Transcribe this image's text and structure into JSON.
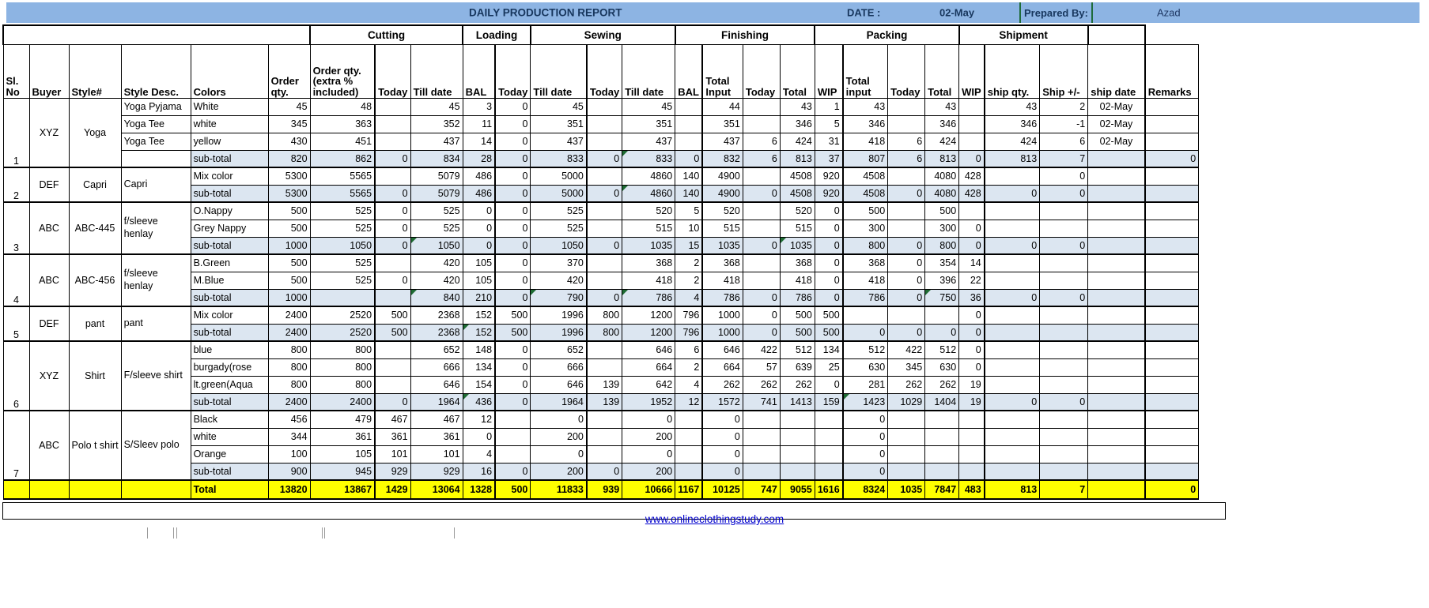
{
  "title": {
    "report": "DAILY PRODUCTION REPORT",
    "date_label": "DATE :",
    "date_value": "02-May",
    "prepared_label": "Prepared By:",
    "prepared_value": "Azad"
  },
  "groups": [
    {
      "label": "",
      "span": 6,
      "style": "beige"
    },
    {
      "label": "Cutting",
      "span": 3,
      "style": "white"
    },
    {
      "label": "Loading",
      "span": 2,
      "style": "green"
    },
    {
      "label": "Sewing",
      "span": 3,
      "style": "white"
    },
    {
      "label": "Finishing",
      "span": 4,
      "style": "green"
    },
    {
      "label": "Packing",
      "span": 4,
      "style": "white"
    },
    {
      "label": "Shipment",
      "span": 3,
      "style": "green"
    },
    {
      "label": "",
      "span": 1,
      "style": "blank"
    }
  ],
  "columns": [
    "Sl. No",
    "Buyer",
    "Style#",
    "Style Desc.",
    "Colors",
    "Order qty.",
    "Order qty. (extra % included)",
    "Today",
    "Till date",
    "BAL",
    "Today",
    "Till date",
    "Today",
    "Till date",
    "BAL",
    "Total Input",
    "Today",
    "Total",
    "WIP",
    "Total input",
    "Today",
    "Total",
    "WIP",
    "ship qty.",
    "Ship +/-",
    "ship date",
    "Remarks"
  ],
  "blocks": [
    {
      "sl": "1",
      "buyer": "XYZ",
      "style": "Yoga",
      "rows": [
        {
          "desc": "Yoga Pyjama",
          "color": "White",
          "v": [
            "45",
            "48",
            "",
            "45",
            "3",
            "0",
            "45",
            "",
            "45",
            "",
            "44",
            "",
            "43",
            "1",
            "43",
            "",
            "43",
            "",
            "43",
            "2",
            "02-May",
            ""
          ]
        },
        {
          "desc": "Yoga Tee",
          "color": "white",
          "v": [
            "345",
            "363",
            "",
            "352",
            "11",
            "0",
            "351",
            "",
            "351",
            "",
            "351",
            "",
            "346",
            "5",
            "346",
            "",
            "346",
            "",
            "346",
            "-1",
            "02-May",
            ""
          ]
        },
        {
          "desc": "Yoga Tee",
          "color": "yellow",
          "v": [
            "430",
            "451",
            "",
            "437",
            "14",
            "0",
            "437",
            "",
            "437",
            "",
            "437",
            "6",
            "424",
            "31",
            "418",
            "6",
            "424",
            "",
            "424",
            "6",
            "02-May",
            ""
          ]
        }
      ],
      "subtotal": {
        "desc": "",
        "color": "sub-total",
        "v": [
          "820",
          "862",
          "0",
          "834",
          "28",
          "0",
          "833",
          "0",
          "833",
          "0",
          "832",
          "6",
          "813",
          "37",
          "807",
          "6",
          "813",
          "0",
          "813",
          "7",
          "",
          "0"
        ]
      }
    },
    {
      "sl": "2",
      "buyer": "DEF",
      "style": "Capri",
      "desc_merged": "Capri",
      "rows": [
        {
          "desc": "Capri",
          "color": "Mix color",
          "v": [
            "5300",
            "5565",
            "",
            "5079",
            "486",
            "0",
            "5000",
            "",
            "4860",
            "140",
            "4900",
            "",
            "4508",
            "920",
            "4508",
            "",
            "4080",
            "428",
            "",
            "0",
            "",
            ""
          ]
        }
      ],
      "subtotal": {
        "desc": "",
        "color": "sub-total",
        "v": [
          "5300",
          "5565",
          "0",
          "5079",
          "486",
          "0",
          "5000",
          "0",
          "4860",
          "140",
          "4900",
          "0",
          "4508",
          "920",
          "4508",
          "0",
          "4080",
          "428",
          "0",
          "0",
          "",
          ""
        ]
      }
    },
    {
      "sl": "3",
      "buyer": "ABC",
      "style": "ABC-445",
      "desc_merged": "f/sleeve henlay",
      "rows": [
        {
          "desc": "",
          "color": "O.Nappy",
          "v": [
            "500",
            "525",
            "0",
            "525",
            "0",
            "0",
            "525",
            "",
            "520",
            "5",
            "520",
            "",
            "520",
            "0",
            "500",
            "",
            "500",
            "",
            "",
            "",
            "",
            ""
          ]
        },
        {
          "desc": "",
          "color": "Grey Nappy",
          "v": [
            "500",
            "525",
            "0",
            "525",
            "0",
            "0",
            "525",
            "",
            "515",
            "10",
            "515",
            "",
            "515",
            "0",
            "300",
            "",
            "300",
            "0",
            "",
            "",
            "",
            ""
          ]
        }
      ],
      "subtotal": {
        "desc": "",
        "color": "sub-total",
        "v": [
          "1000",
          "1050",
          "0",
          "1050",
          "0",
          "0",
          "1050",
          "0",
          "1035",
          "15",
          "1035",
          "0",
          "1035",
          "0",
          "800",
          "0",
          "800",
          "0",
          "0",
          "0",
          "",
          ""
        ]
      }
    },
    {
      "sl": "4",
      "buyer": "ABC",
      "style": "ABC-456",
      "desc_merged": "f/sleeve henlay",
      "rows": [
        {
          "desc": "",
          "color": "B.Green",
          "v": [
            "500",
            "525",
            "",
            "420",
            "105",
            "0",
            "370",
            "",
            "368",
            "2",
            "368",
            "",
            "368",
            "0",
            "368",
            "0",
            "354",
            "14",
            "",
            "",
            "",
            ""
          ]
        },
        {
          "desc": "",
          "color": "M.Blue",
          "v": [
            "500",
            "525",
            "0",
            "420",
            "105",
            "0",
            "420",
            "",
            "418",
            "2",
            "418",
            "",
            "418",
            "0",
            "418",
            "0",
            "396",
            "22",
            "",
            "",
            "",
            ""
          ]
        }
      ],
      "subtotal": {
        "desc": "",
        "color": "sub-total",
        "v": [
          "1000",
          "",
          "",
          "840",
          "210",
          "0",
          "790",
          "0",
          "786",
          "4",
          "786",
          "0",
          "786",
          "0",
          "786",
          "0",
          "750",
          "36",
          "0",
          "0",
          "",
          ""
        ]
      }
    },
    {
      "sl": "5",
      "buyer": "DEF",
      "style": "pant",
      "desc_merged": "pant",
      "rows": [
        {
          "desc": "",
          "color": "Mix color",
          "v": [
            "2400",
            "2520",
            "500",
            "2368",
            "152",
            "500",
            "1996",
            "800",
            "1200",
            "796",
            "1000",
            "0",
            "500",
            "500",
            "",
            "",
            "",
            "0",
            "",
            "",
            "",
            ""
          ]
        }
      ],
      "subtotal": {
        "desc": "",
        "color": "sub-total",
        "v": [
          "2400",
          "2520",
          "500",
          "2368",
          "152",
          "500",
          "1996",
          "800",
          "1200",
          "796",
          "1000",
          "0",
          "500",
          "500",
          "0",
          "0",
          "0",
          "0",
          "",
          "",
          "",
          ""
        ]
      }
    },
    {
      "sl": "6",
      "buyer": "XYZ",
      "style": "Shirt",
      "desc_merged": "F/sleeve shirt",
      "rows": [
        {
          "desc": "",
          "color": "blue",
          "v": [
            "800",
            "800",
            "",
            "652",
            "148",
            "0",
            "652",
            "",
            "646",
            "6",
            "646",
            "422",
            "512",
            "134",
            "512",
            "422",
            "512",
            "0",
            "",
            "",
            "",
            ""
          ]
        },
        {
          "desc": "",
          "color": "burgady(rose",
          "v": [
            "800",
            "800",
            "",
            "666",
            "134",
            "0",
            "666",
            "",
            "664",
            "2",
            "664",
            "57",
            "639",
            "25",
            "630",
            "345",
            "630",
            "0",
            "",
            "",
            "",
            ""
          ]
        },
        {
          "desc": "",
          "color": "lt.green(Aqua",
          "v": [
            "800",
            "800",
            "",
            "646",
            "154",
            "0",
            "646",
            "139",
            "642",
            "4",
            "262",
            "262",
            "262",
            "0",
            "281",
            "262",
            "262",
            "19",
            "",
            "",
            "",
            ""
          ]
        }
      ],
      "subtotal": {
        "desc": "",
        "color": "sub-total",
        "v": [
          "2400",
          "2400",
          "0",
          "1964",
          "436",
          "0",
          "1964",
          "139",
          "1952",
          "12",
          "1572",
          "741",
          "1413",
          "159",
          "1423",
          "1029",
          "1404",
          "19",
          "0",
          "0",
          "",
          ""
        ]
      }
    },
    {
      "sl": "7",
      "buyer": "ABC",
      "style": "Polo t shirt",
      "desc_merged": "S/Sleev polo",
      "rows": [
        {
          "desc": "",
          "color": "Black",
          "v": [
            "456",
            "479",
            "467",
            "467",
            "12",
            "",
            "0",
            "",
            "0",
            "",
            "0",
            "",
            "",
            "",
            "0",
            "",
            "",
            "",
            "",
            "",
            "",
            ""
          ]
        },
        {
          "desc": "",
          "color": "white",
          "v": [
            "344",
            "361",
            "361",
            "361",
            "0",
            "",
            "200",
            "",
            "200",
            "",
            "0",
            "",
            "",
            "",
            "0",
            "",
            "",
            "",
            "",
            "",
            "",
            ""
          ]
        },
        {
          "desc": "",
          "color": "Orange",
          "v": [
            "100",
            "105",
            "101",
            "101",
            "4",
            "",
            "0",
            "",
            "0",
            "",
            "0",
            "",
            "",
            "",
            "0",
            "",
            "",
            "",
            "",
            "",
            "",
            ""
          ]
        }
      ],
      "subtotal": {
        "desc": "",
        "color": "sub-total",
        "v": [
          "900",
          "945",
          "929",
          "929",
          "16",
          "0",
          "200",
          "0",
          "200",
          "",
          "0",
          "",
          "",
          "",
          "0",
          "",
          "",
          "",
          "",
          "",
          "",
          ""
        ]
      }
    }
  ],
  "total_row": {
    "label": "Total",
    "v": [
      "13820",
      "13867",
      "1429",
      "13064",
      "1328",
      "500",
      "11833",
      "939",
      "10666",
      "1167",
      "10125",
      "747",
      "9055",
      "1616",
      "8324",
      "1035",
      "7847",
      "483",
      "813",
      "7",
      "",
      "0"
    ]
  },
  "footer": {
    "link": "www.onlineclothingstudy.com"
  },
  "colors": {
    "title_band": "#8db4e3",
    "group_beige": "#ddd9c4",
    "group_green": "#c3d69b",
    "subtotal_fill": "#dce6f1",
    "total_fill": "#ffff00",
    "comment_marker": "#1e6b33"
  }
}
